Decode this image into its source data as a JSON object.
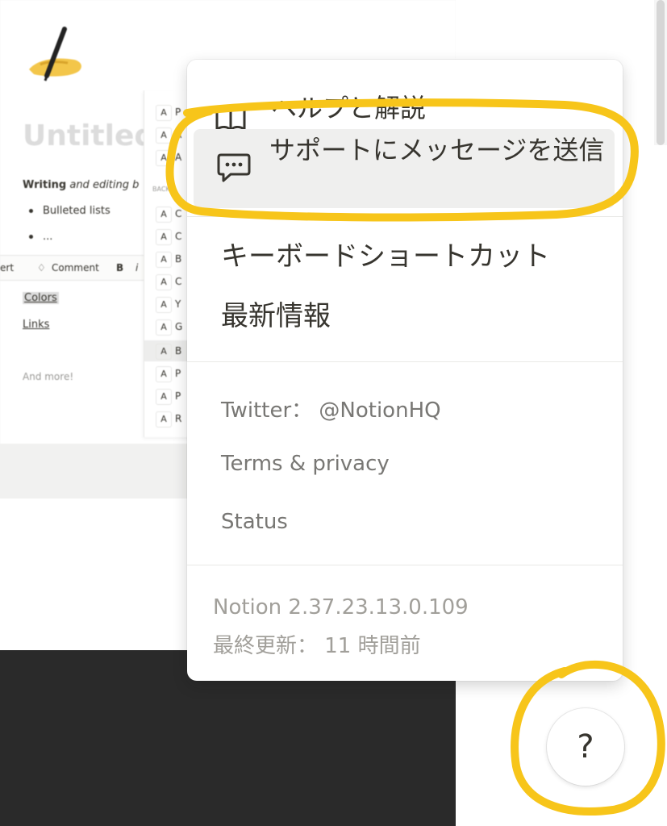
{
  "background_page": {
    "title": "Untitled",
    "writing_line_bold": "Writing",
    "writing_line_rest": " and editing b",
    "bullets": [
      "Bulleted lists",
      "..."
    ],
    "toolbar": {
      "left_fragment": "ert",
      "comment_label": "Comment",
      "bold_glyph": "B",
      "italic_glyph": "i"
    },
    "colors_label": "Colors",
    "links_label": "Links",
    "and_more_label": "And more!",
    "font_list": {
      "section_label": "BACK",
      "glyph": "A",
      "rows_top": [
        "P",
        "A",
        "A"
      ],
      "rows_bottom": [
        "C",
        "C",
        "B",
        "C",
        "Y",
        "G",
        "B",
        "P",
        "P",
        "R"
      ]
    }
  },
  "help_menu": {
    "help_label": "ヘルプと解説",
    "support_label": "サポートにメッセージを送信",
    "shortcuts_label": "キーボードショートカット",
    "whats_new_label": "最新情報",
    "twitter_label": "Twitter： @NotionHQ",
    "terms_label": "Terms & privacy",
    "status_label": "Status",
    "version_label": "Notion 2.37.23.13.0.109",
    "updated_label": "最終更新： 11 時間前"
  },
  "help_button": {
    "label": "?"
  },
  "colors": {
    "annotation_yellow": "#f7c51a",
    "menu_text": "#37352f",
    "muted_text": "#787774",
    "selected_bg": "#efefee"
  }
}
